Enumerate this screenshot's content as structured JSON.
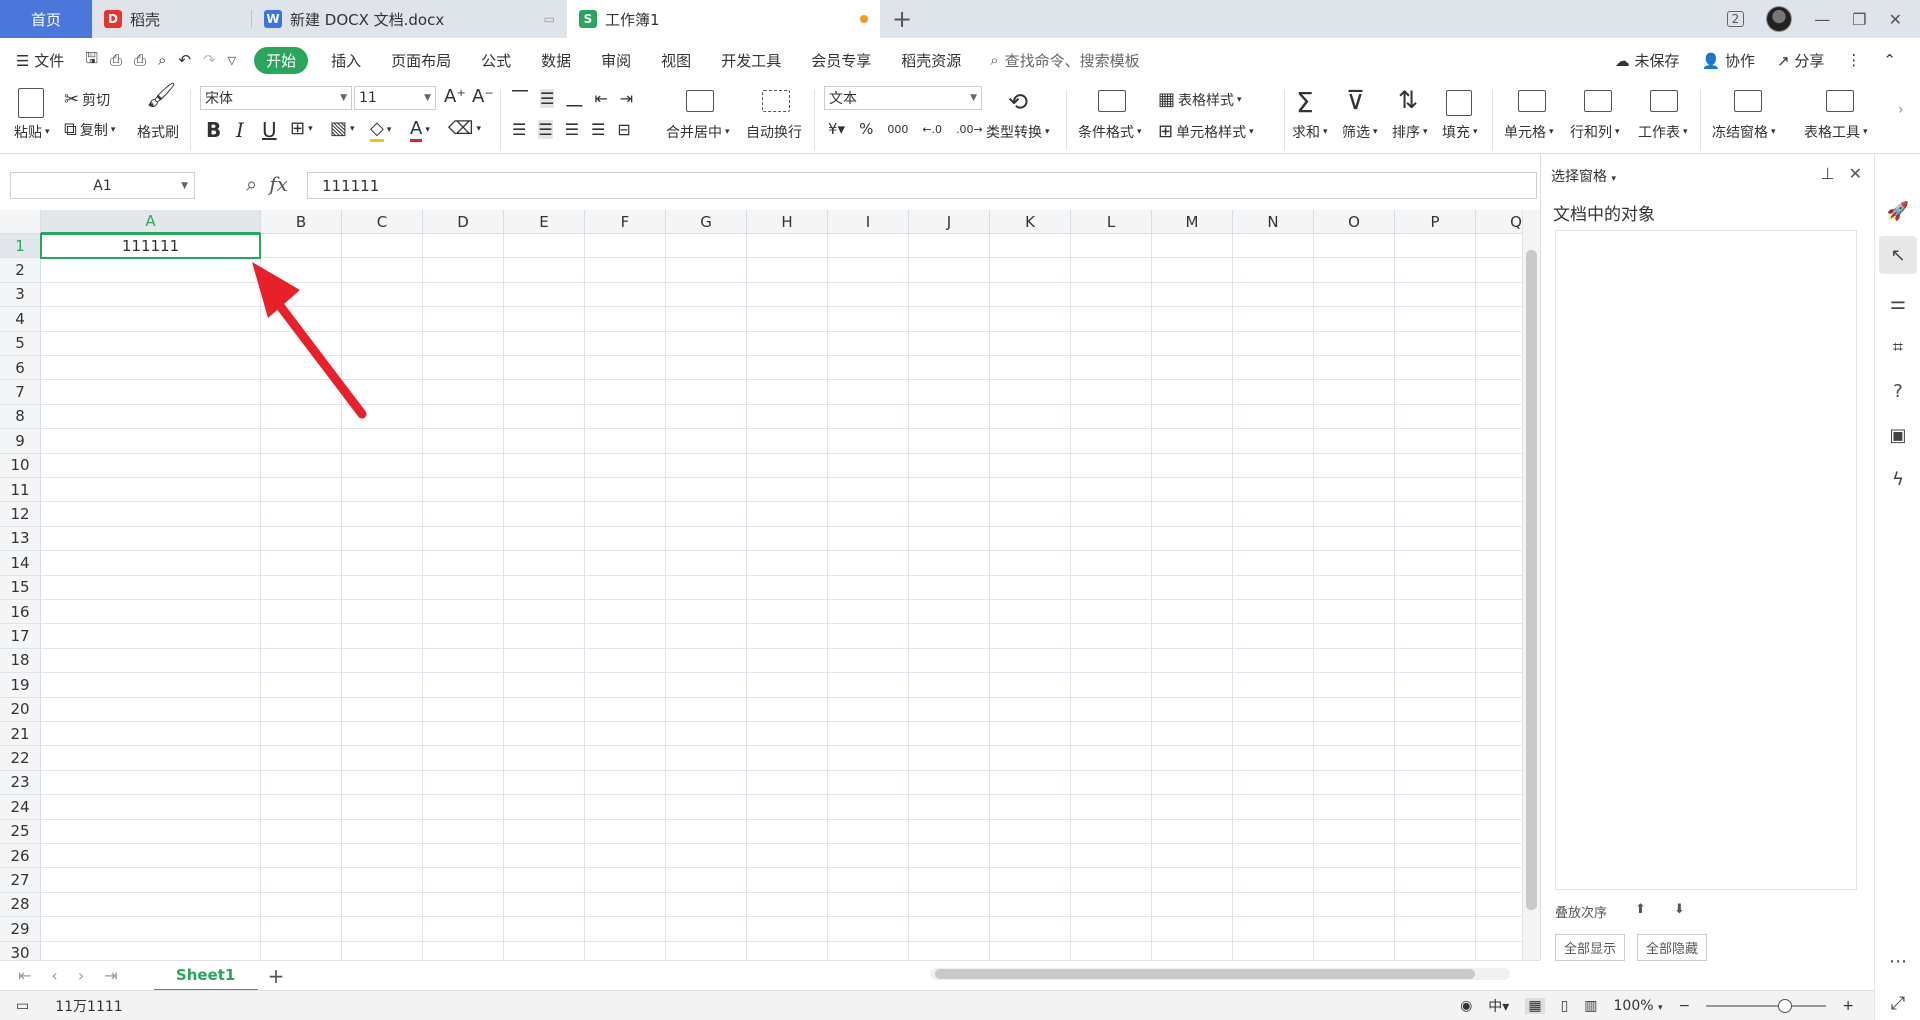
{
  "tabs": [
    {
      "label": "首页"
    },
    {
      "label": "稻壳"
    },
    {
      "label": "新建 DOCX 文档.docx"
    },
    {
      "label": "工作簿1"
    }
  ],
  "tab_icons": {
    "daoke": "D",
    "word": "W",
    "sheet": "S"
  },
  "window": {
    "badge": "2"
  },
  "menu": {
    "file": "文件",
    "items": [
      "开始",
      "插入",
      "页面布局",
      "公式",
      "数据",
      "审阅",
      "视图",
      "开发工具",
      "会员专享",
      "稻壳资源"
    ],
    "search_placeholder": "查找命令、搜索模板",
    "unsaved": "未保存",
    "collab": "协作",
    "share": "分享"
  },
  "ribbon": {
    "paste": "粘贴",
    "cut": "剪切",
    "copy": "复制",
    "format_painter": "格式刷",
    "font_name": "宋体",
    "font_size": "11",
    "merge_center": "合并居中",
    "wrap_text": "自动换行",
    "number_format": "文本",
    "type_convert": "类型转换",
    "conditional_format": "条件格式",
    "table_style": "表格样式",
    "cell_style": "单元格样式",
    "sum": "求和",
    "filter": "筛选",
    "sort": "排序",
    "fill": "填充",
    "cells": "单元格",
    "rows_cols": "行和列",
    "worksheet": "工作表",
    "freeze": "冻结窗格",
    "table_tools": "表格工具"
  },
  "formula": {
    "cell_ref": "A1",
    "fx": "fx",
    "value": "111111"
  },
  "grid": {
    "columns": [
      "A",
      "B",
      "C",
      "D",
      "E",
      "F",
      "G",
      "H",
      "I",
      "J",
      "K",
      "L",
      "M",
      "N",
      "O",
      "P",
      "Q"
    ],
    "rows": [
      "1",
      "2",
      "3",
      "4",
      "5",
      "6",
      "7",
      "8",
      "9",
      "10",
      "11",
      "12",
      "13",
      "14",
      "15",
      "16",
      "17",
      "18",
      "19",
      "20",
      "21",
      "22",
      "23",
      "24",
      "25",
      "26",
      "27",
      "28",
      "29",
      "30"
    ],
    "a1_value": "111111",
    "selected_col": "A",
    "selected_row": "1"
  },
  "pane": {
    "title": "选择窗格",
    "subtitle": "文档中的对象",
    "foot_left": "叠放次序",
    "show_all": "全部显示",
    "hide_all": "全部隐藏"
  },
  "sheets": {
    "active": "Sheet1"
  },
  "status": {
    "sum_text": "11万1111",
    "zoom": "100%"
  },
  "accent": "#2aa65c",
  "annotation_color": "#e8202a"
}
